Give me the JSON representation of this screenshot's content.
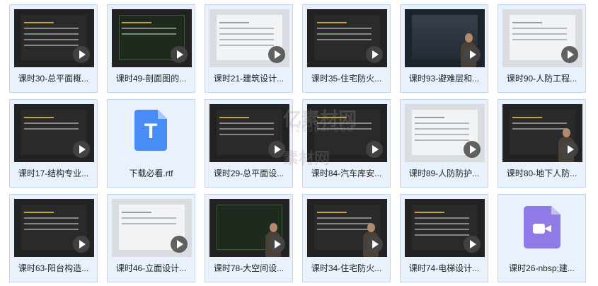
{
  "files": [
    {
      "label": "课时30-总平面概...",
      "kind": "video",
      "style": "dark"
    },
    {
      "label": "课时49-剖面图的...",
      "kind": "video",
      "style": "plan"
    },
    {
      "label": "课时21-建筑设计...",
      "kind": "video",
      "style": "light"
    },
    {
      "label": "课时35-住宅防火...",
      "kind": "video",
      "style": "dark"
    },
    {
      "label": "课时93-避难层和...",
      "kind": "video",
      "style": "build"
    },
    {
      "label": "课时90-人防工程...",
      "kind": "video",
      "style": "light"
    },
    {
      "label": "课时17-结构专业...",
      "kind": "video",
      "style": "dark"
    },
    {
      "label": "下载必看.rtf",
      "kind": "rtf",
      "icon": "T"
    },
    {
      "label": "课时29-总平面设...",
      "kind": "video",
      "style": "dark"
    },
    {
      "label": "课时84-汽车库安...",
      "kind": "video",
      "style": "dark"
    },
    {
      "label": "课时89-人防防护...",
      "kind": "video",
      "style": "light"
    },
    {
      "label": "课时80-地下人防...",
      "kind": "video",
      "style": "dark"
    },
    {
      "label": "课时63-阳台构造...",
      "kind": "video",
      "style": "dark"
    },
    {
      "label": "课时46-立面设计...",
      "kind": "video",
      "style": "light"
    },
    {
      "label": "课时78-大空间设...",
      "kind": "video",
      "style": "plan"
    },
    {
      "label": "课时34-住宅防火...",
      "kind": "video",
      "style": "dark"
    },
    {
      "label": "课时74-电梯设计...",
      "kind": "video",
      "style": "dark"
    },
    {
      "label": "课时26-nbsp;建...",
      "kind": "videofile"
    }
  ],
  "watermark": {
    "brand": "亿素材网",
    "url": "TZSUCAI.COM",
    "sub": "素材网"
  },
  "colors": {
    "tile_bg": "#e9f1fc",
    "tile_border": "#c4d6ee",
    "rtf_icon": "#4a8cf5",
    "video_icon": "#8f7ae6"
  }
}
